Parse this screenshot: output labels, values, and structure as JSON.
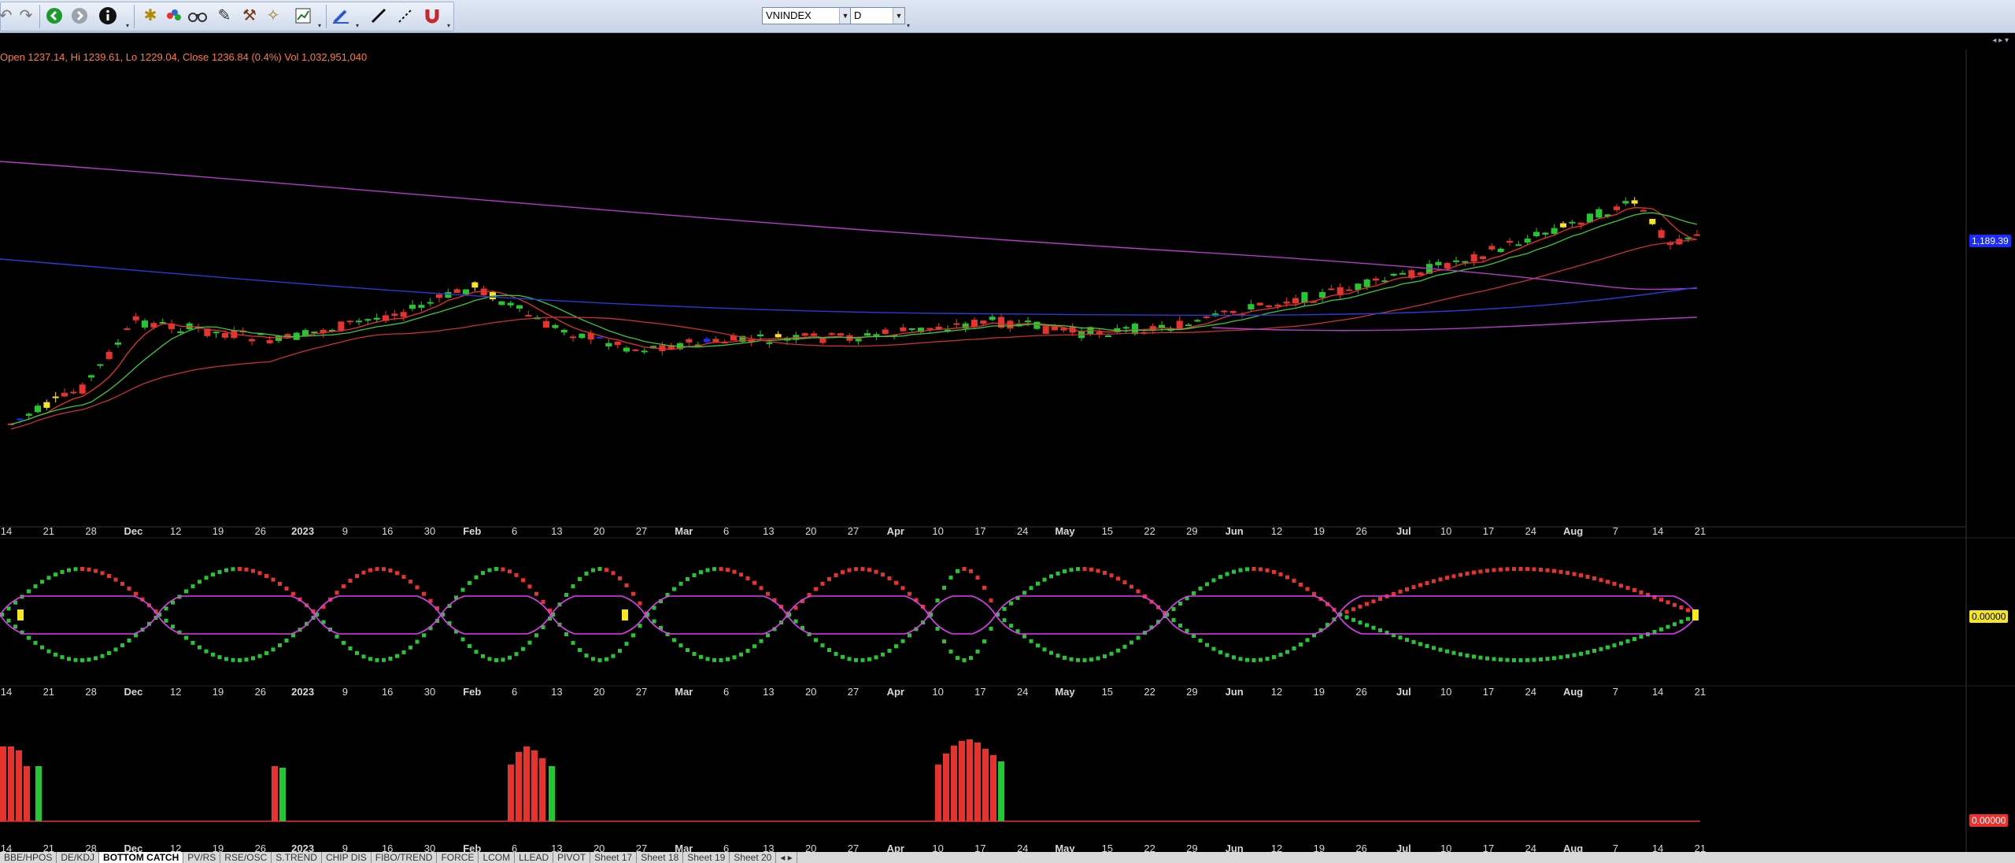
{
  "toolbar": {
    "symbol": "VNINDEX",
    "period": "D",
    "icons": [
      "undo-icon",
      "redo-icon",
      "back-icon",
      "forward-icon",
      "info-icon",
      "gear-icon",
      "colors-icon",
      "binoculars-icon",
      "edit-icon",
      "hammer-icon",
      "wand-icon",
      "chart-icon",
      "pen-icon",
      "line-icon",
      "dash-icon",
      "magnet-icon"
    ]
  },
  "ohlc_text": "Open 1237.14, Hi 1239.61, Lo 1229.04, Close 1236.84 (0.4%) Vol 1,032,951,040",
  "price_tags": {
    "main": "1,189.39",
    "osc": "0.00000",
    "hist": "0.00000"
  },
  "axis": {
    "labels": [
      {
        "t": "14",
        "b": false
      },
      {
        "t": "21",
        "b": false
      },
      {
        "t": "28",
        "b": false
      },
      {
        "t": "Dec",
        "b": true
      },
      {
        "t": "12",
        "b": false
      },
      {
        "t": "19",
        "b": false
      },
      {
        "t": "26",
        "b": false
      },
      {
        "t": "2023",
        "b": true
      },
      {
        "t": "9",
        "b": false
      },
      {
        "t": "16",
        "b": false
      },
      {
        "t": "30",
        "b": false
      },
      {
        "t": "Feb",
        "b": true
      },
      {
        "t": "6",
        "b": false
      },
      {
        "t": "13",
        "b": false
      },
      {
        "t": "20",
        "b": false
      },
      {
        "t": "27",
        "b": false
      },
      {
        "t": "Mar",
        "b": true
      },
      {
        "t": "6",
        "b": false
      },
      {
        "t": "13",
        "b": false
      },
      {
        "t": "20",
        "b": false
      },
      {
        "t": "27",
        "b": false
      },
      {
        "t": "Apr",
        "b": true
      },
      {
        "t": "10",
        "b": false
      },
      {
        "t": "17",
        "b": false
      },
      {
        "t": "24",
        "b": false
      },
      {
        "t": "May",
        "b": true
      },
      {
        "t": "15",
        "b": false
      },
      {
        "t": "22",
        "b": false
      },
      {
        "t": "29",
        "b": false
      },
      {
        "t": "Jun",
        "b": true
      },
      {
        "t": "12",
        "b": false
      },
      {
        "t": "19",
        "b": false
      },
      {
        "t": "26",
        "b": false
      },
      {
        "t": "Jul",
        "b": true
      },
      {
        "t": "10",
        "b": false
      },
      {
        "t": "17",
        "b": false
      },
      {
        "t": "24",
        "b": false
      },
      {
        "t": "Aug",
        "b": true
      },
      {
        "t": "7",
        "b": false
      },
      {
        "t": "14",
        "b": false
      },
      {
        "t": "21",
        "b": false
      }
    ]
  },
  "colors": {
    "up": "#22c832",
    "down": "#e8322d",
    "highlight": "#f5e61e",
    "blue": "#1a2cff",
    "ma_long": "#b43cc8",
    "ma_mid": "#2a3ad2",
    "ma_short": "#c83232",
    "ma_fast": "#3cc83c"
  },
  "tabs": [
    "BBE/HPOS",
    "DE/KDJ",
    "BOTTOM CATCH",
    "PV/RS",
    "RSE/OSC",
    "S.TREND",
    "CHIP DIS",
    "FIBO/TREND",
    "FORCE",
    "LCOM",
    "LLEAD",
    "PIVOT",
    "Sheet 17",
    "Sheet 18",
    "Sheet 19",
    "Sheet 20"
  ],
  "active_tab": "BOTTOM CATCH"
}
